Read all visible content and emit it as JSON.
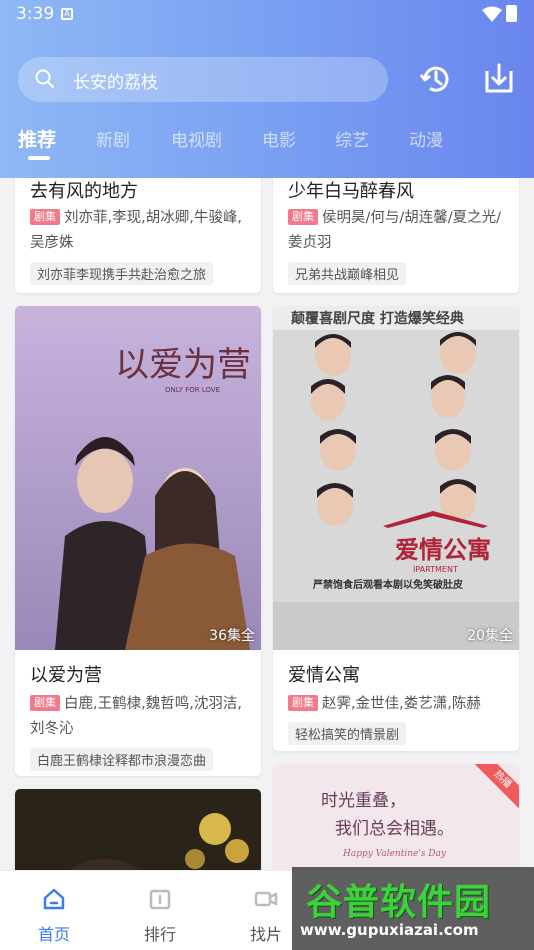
{
  "status": {
    "time": "3:39"
  },
  "search": {
    "query": "长安的荔枝"
  },
  "tabs": [
    "推荐",
    "新剧",
    "电视剧",
    "电影",
    "综艺",
    "动漫"
  ],
  "cards": [
    {
      "title": "去有风的地方",
      "badge": "剧集",
      "cast": "刘亦菲,李现,胡冰卿,牛骏峰,吴彦姝",
      "tag": "刘亦菲李现携手共赴治愈之旅"
    },
    {
      "title": "少年白马醉春风",
      "badge": "剧集",
      "cast": "侯明昊/何与/胡连馨/夏之光/姜贞羽",
      "tag": "兄弟共战巅峰相见"
    },
    {
      "title": "以爱为营",
      "badge": "剧集",
      "cast": "白鹿,王鹤棣,魏哲鸣,沈羽洁,刘冬沁",
      "tag": "白鹿王鹤棣诠释都市浪漫恋曲",
      "episodes": "36集全",
      "poster_text": {
        "main": "以爱为营",
        "sub": "ONLY FOR LOVE"
      }
    },
    {
      "title": "爱情公寓",
      "badge": "剧集",
      "cast": "赵霁,金世佳,娄艺潇,陈赫",
      "tag": "轻松搞笑的情景剧",
      "episodes": "20集全",
      "poster_text": {
        "top": "颠覆喜剧尺度  打造爆笑经典",
        "logo": "爱情公寓",
        "logo_en": "IPARTMENT",
        "bottom": "严禁饱食后观看本剧以免笑破肚皮"
      }
    },
    {
      "title": "",
      "poster_text": {}
    },
    {
      "title": "",
      "hot": "热播",
      "poster_text": {
        "line1": "时光重叠，",
        "line2": "我们总会相遇。",
        "line3": "Happy Valentine's Day"
      }
    }
  ],
  "navbar": {
    "items": [
      {
        "label": "首页"
      },
      {
        "label": "排行"
      },
      {
        "label": "找片"
      }
    ]
  },
  "watermark": {
    "brand": "谷普软件园",
    "url": "www.gupuxiazai.com"
  },
  "colors": {
    "accent": "#3c7cf0",
    "badge": "#f27a8a",
    "header_start": "#8fb8f4",
    "header_end": "#6a86ee"
  }
}
